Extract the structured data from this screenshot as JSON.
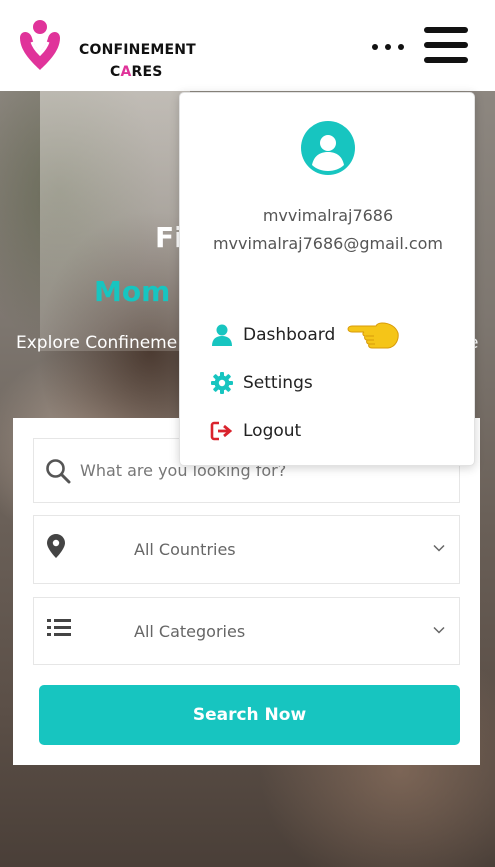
{
  "brand": {
    "name_line1": "CONFINEMENT",
    "name_line2_pre": "C",
    "name_line2_accent": "A",
    "name_line2_post": "RES",
    "pink": "#e0339a"
  },
  "header": {
    "more_icon": "more-dots-icon",
    "menu_icon": "hamburger-menu-icon"
  },
  "hero": {
    "title_partial": "Fi",
    "subtitle_word": "Mom",
    "explore_text": "Explore Confineme",
    "explore_tail": "e",
    "accent": "#17c5c0"
  },
  "search": {
    "placeholder": "What are you looking for?",
    "country_value": "All Countries",
    "category_value": "All Categories",
    "button_label": "Search Now",
    "button_color": "#17c5c0"
  },
  "user_menu": {
    "username": "mvvimalraj7686",
    "email": "mvvimalraj7686@gmail.com",
    "items": [
      {
        "label": "Dashboard",
        "icon": "user-icon"
      },
      {
        "label": "Settings",
        "icon": "gear-icon"
      },
      {
        "label": "Logout",
        "icon": "logout-icon"
      }
    ],
    "pointer_icon": "pointing-hand-emoji"
  }
}
